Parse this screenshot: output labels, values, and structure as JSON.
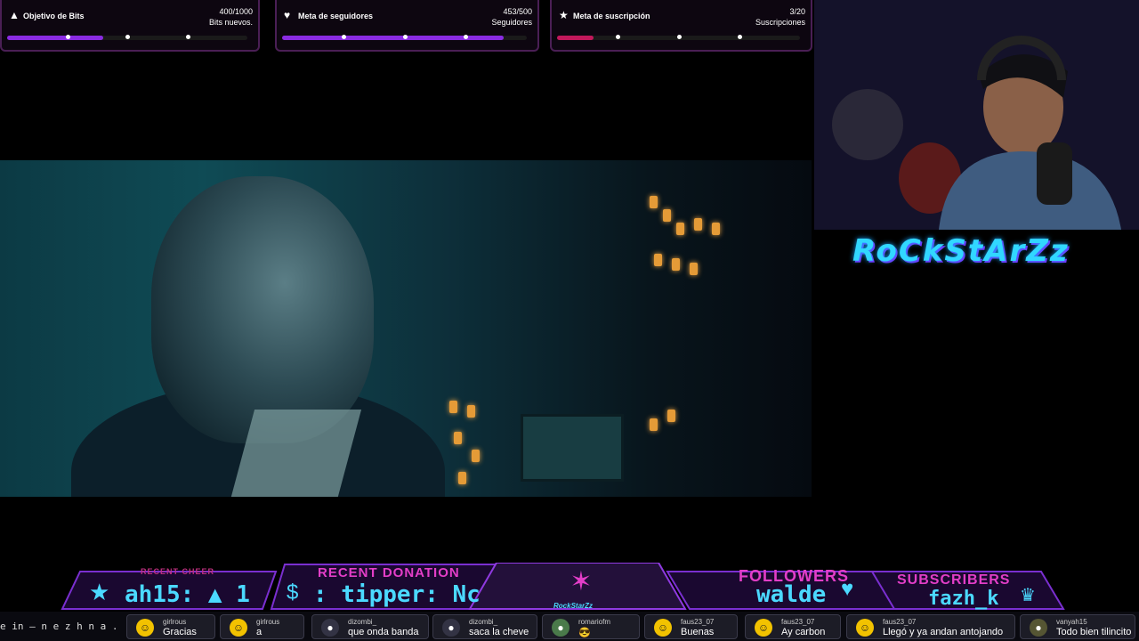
{
  "goals": [
    {
      "icon": "▲",
      "title": "Objetivo de Bits",
      "count": "400/1000",
      "sub": "Bits nuevos.",
      "fill": 0.4,
      "color": "#8a2be2"
    },
    {
      "icon": "♥",
      "title": "Meta de seguidores",
      "count": "453/500",
      "sub": "Seguidores",
      "fill": 0.906,
      "color": "#8a2be2"
    },
    {
      "icon": "★",
      "title": "Meta de suscripción",
      "count": "3/20",
      "sub": "Suscripciones",
      "fill": 0.15,
      "color": "#c2185b"
    }
  ],
  "logo": "RoCkStArZz",
  "bottom": {
    "recent_cheer_label": "RECENT CHEER",
    "recent_cheer_value": "ah15: ▲ 1",
    "recent_donation_label": "RECENT DONATION",
    "recent_donation_value": ": tipper: Nc",
    "center_logo_text": "RockStarZz",
    "followers_label": "FOLLOWERS",
    "followers_value": "walde",
    "subscribers_label": "SUBSCRIBERS",
    "subscribers_value": "fazh_k"
  },
  "chat": {
    "ticker": "e in — n e z h n a . c o m",
    "messages": [
      {
        "user": "girlrous",
        "text": "Gracias"
      },
      {
        "user": "girlrous",
        "text": "a"
      },
      {
        "user": "dizombi_",
        "text": "que onda banda"
      },
      {
        "user": "dizombi_",
        "text": "saca la cheve"
      },
      {
        "user": "romariofm",
        "text": "😎"
      },
      {
        "user": "faus23_07",
        "text": "Buenas"
      },
      {
        "user": "faus23_07",
        "text": "Ay carbon"
      },
      {
        "user": "faus23_07",
        "text": "Llegó y ya andan antojando"
      },
      {
        "user": "vanyah15",
        "text": "Todo bien tilincito"
      }
    ]
  },
  "colors": {
    "accent": "#e33ec8",
    "cyan": "#4bd9ff",
    "purple": "#8a2be2"
  }
}
